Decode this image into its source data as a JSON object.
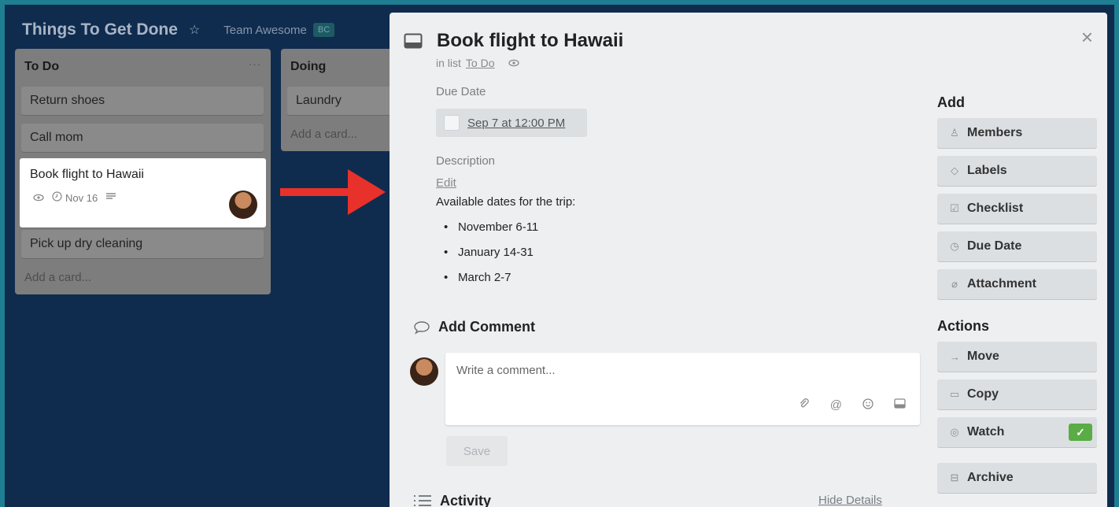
{
  "board": {
    "title": "Things To Get Done",
    "team": "Team Awesome",
    "team_badge": "BC"
  },
  "lists": [
    {
      "title": "To Do",
      "menu": "···",
      "cards": [
        "Return shoes",
        "Call mom",
        "Book flight to Hawaii",
        "Pick up dry cleaning"
      ],
      "highlight_card_due": "Nov 16",
      "add_card": "Add a card..."
    },
    {
      "title": "Doing",
      "cards": [
        "Laundry"
      ],
      "add_card": "Add a card..."
    }
  ],
  "modal": {
    "title": "Book flight to Hawaii",
    "in_list_prefix": "in list",
    "in_list_name": "To Do",
    "close": "×",
    "due_label": "Due Date",
    "due_value": "Sep 7 at 12:00 PM",
    "description_label": "Description",
    "edit": "Edit",
    "description_text": "Available dates for the trip:",
    "description_items": [
      "November 6-11",
      "January 14-31",
      "March 2-7"
    ],
    "add_comment": "Add Comment",
    "comment_placeholder": "Write a comment...",
    "save": "Save",
    "activity": "Activity",
    "hide_details": "Hide Details"
  },
  "sidebar": {
    "add_heading": "Add",
    "add_buttons": [
      "Members",
      "Labels",
      "Checklist",
      "Due Date",
      "Attachment"
    ],
    "actions_heading": "Actions",
    "action_buttons": [
      "Move",
      "Copy",
      "Watch",
      "Archive"
    ],
    "watch_checked": "✓"
  },
  "colors": {
    "background": "#0f2c4f",
    "border": "#1f7e91",
    "arrow": "#e8312a",
    "watch_check": "#5aac44"
  }
}
